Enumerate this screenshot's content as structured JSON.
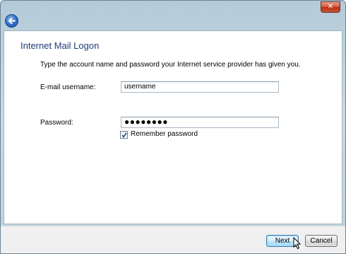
{
  "window": {
    "close_glyph": "✕"
  },
  "page": {
    "title": "Internet Mail Logon",
    "instructions": "Type the account name and password your Internet service provider has given you."
  },
  "form": {
    "username_label": "E-mail username:",
    "username_value": "username",
    "password_label": "Password:",
    "password_value": "●●●●●●●●",
    "remember_label": "Remember password",
    "remember_checked": true
  },
  "buttons": {
    "next": "Next",
    "cancel": "Cancel"
  },
  "icons": {
    "back": "back-arrow-icon",
    "close": "close-icon",
    "checkmark": "checkmark-icon",
    "cursor": "mouse-cursor-icon"
  },
  "colors": {
    "title": "#1f3c7a",
    "next_border": "#3c7fb1",
    "close_red": "#c9563a"
  }
}
